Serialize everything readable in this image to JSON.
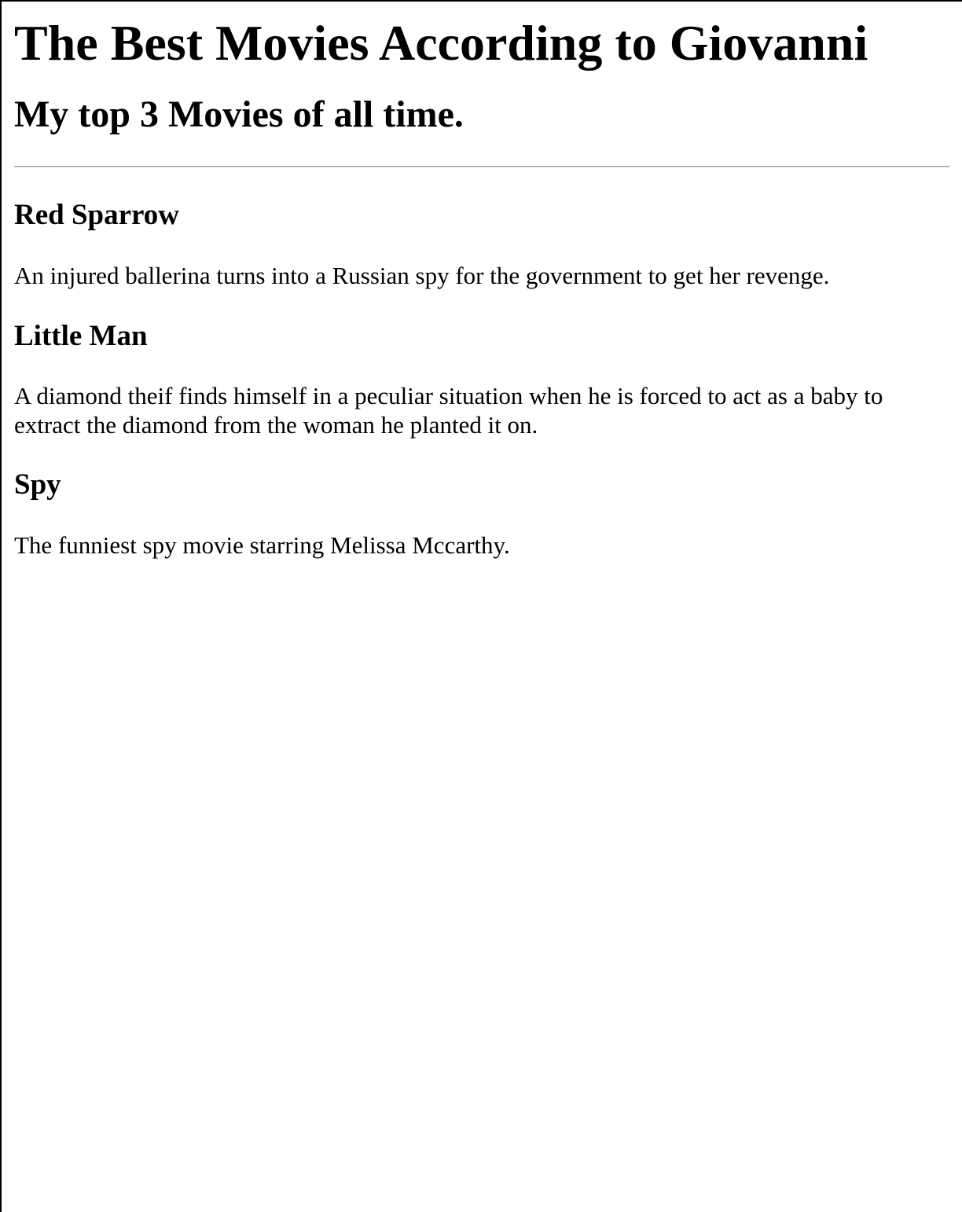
{
  "page": {
    "title": "The Best Movies According to Giovanni",
    "subtitle": "My top 3 Movies of all time."
  },
  "movies": [
    {
      "title": "Red Sparrow",
      "description": "An injured ballerina turns into a Russian spy for the government to get her revenge."
    },
    {
      "title": "Little Man",
      "description": "A diamond theif finds himself in a peculiar situation when he is forced to act as a baby to extract the diamond from the woman he planted it on."
    },
    {
      "title": "Spy",
      "description": "The funniest spy movie starring Melissa Mccarthy."
    }
  ]
}
